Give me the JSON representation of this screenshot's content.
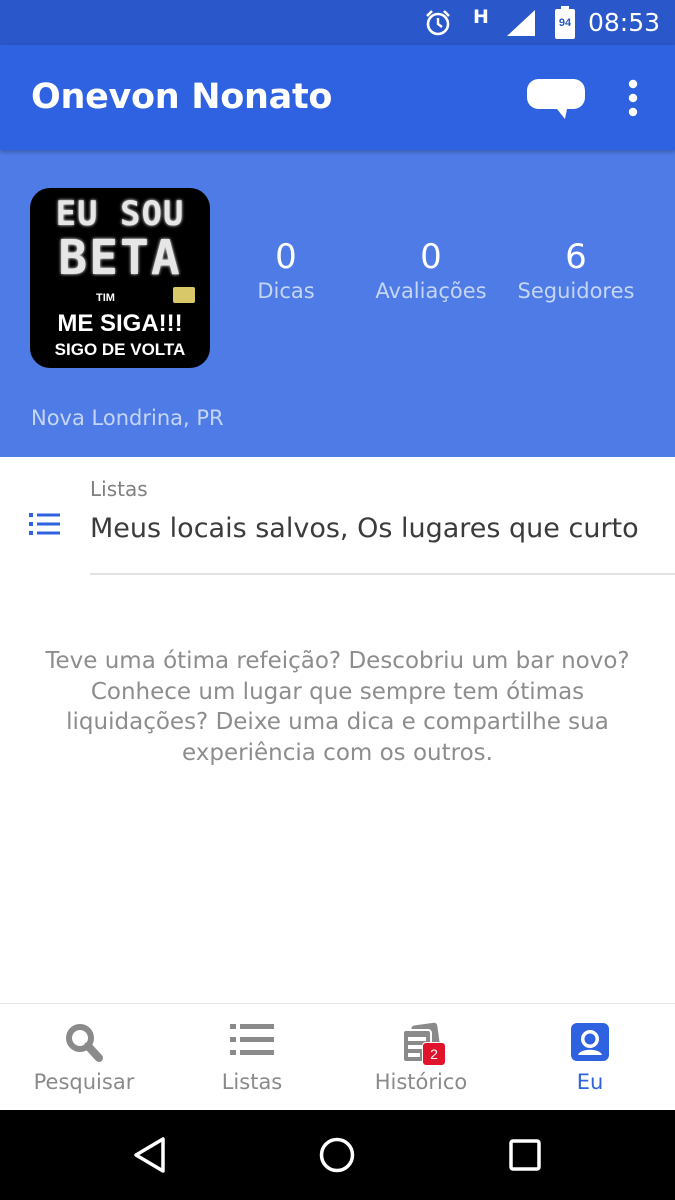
{
  "status_bar": {
    "time": "08:53",
    "network": "H",
    "battery": "94"
  },
  "app_bar": {
    "title": "Onevon Nonato",
    "chat_icon": "chat-bubble-icon",
    "more_icon": "more-vert-icon"
  },
  "profile": {
    "avatar_text": {
      "line1": "EU SOU",
      "line2": "BETA",
      "brand": "TIM",
      "line3": "ME SIGA!!!",
      "line4": "SIGO DE VOLTA"
    },
    "stats": [
      {
        "value": "0",
        "label": "Dicas"
      },
      {
        "value": "0",
        "label": "Avaliações"
      },
      {
        "value": "6",
        "label": "Seguidores"
      }
    ],
    "location": "Nova Londrina, PR"
  },
  "lists": {
    "caption": "Listas",
    "value": "Meus locais salvos, Os lugares que curto"
  },
  "empty_message": "Teve uma ótima refeição? Descobriu um bar novo? Conhece um lugar que sempre tem ótimas liquidações? Deixe uma dica e compartilhe sua experiência com os outros.",
  "bottom_nav": {
    "items": [
      {
        "label": "Pesquisar",
        "icon": "search-icon"
      },
      {
        "label": "Listas",
        "icon": "list-icon"
      },
      {
        "label": "Histórico",
        "icon": "history-icon"
      },
      {
        "label": "Eu",
        "icon": "profile-icon"
      }
    ],
    "active_index": 3,
    "history_badge": "2"
  },
  "colors": {
    "status_bar": "#2a57c9",
    "app_bar": "#2f62e0",
    "profile_header": "#4e7be6",
    "accent": "#2f62e0",
    "badge": "#e0142a"
  }
}
